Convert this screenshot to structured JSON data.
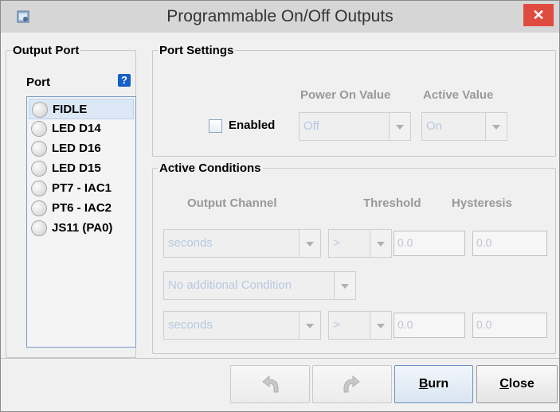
{
  "window": {
    "title": "Programmable On/Off Outputs",
    "close_label": "✕",
    "app_icon": "app-window-icon"
  },
  "output_port": {
    "legend": "Output Port",
    "port_label": "Port",
    "help_glyph": "?",
    "items": [
      {
        "label": "FIDLE",
        "selected": true
      },
      {
        "label": "LED D14"
      },
      {
        "label": "LED D16"
      },
      {
        "label": "LED D15"
      },
      {
        "label": "PT7 - IAC1"
      },
      {
        "label": "PT6 - IAC2"
      },
      {
        "label": "JS11 (PA0)"
      }
    ]
  },
  "port_settings": {
    "legend": "Port Settings",
    "enabled_label": "Enabled",
    "power_on_label": "Power On Value",
    "active_value_label": "Active Value",
    "power_on_value": "Off",
    "active_value": "On"
  },
  "active_conditions": {
    "legend": "Active Conditions",
    "output_channel_label": "Output Channel",
    "threshold_label": "Threshold",
    "hysteresis_label": "Hysteresis",
    "row1": {
      "channel": "seconds",
      "operator": ">",
      "threshold": "0.0",
      "hysteresis": "0.0"
    },
    "additional": "No additional Condition",
    "row2": {
      "channel": "seconds",
      "operator": ">",
      "threshold": "0.0",
      "hysteresis": "0.0"
    }
  },
  "buttons": {
    "undo_icon": "undo-icon",
    "redo_icon": "redo-icon",
    "burn_mnemonic": "B",
    "burn_rest": "urn",
    "close_mnemonic": "C",
    "close_rest": "lose"
  },
  "colors": {
    "close_bg": "#e04b40",
    "help_bg": "#1560c8"
  }
}
